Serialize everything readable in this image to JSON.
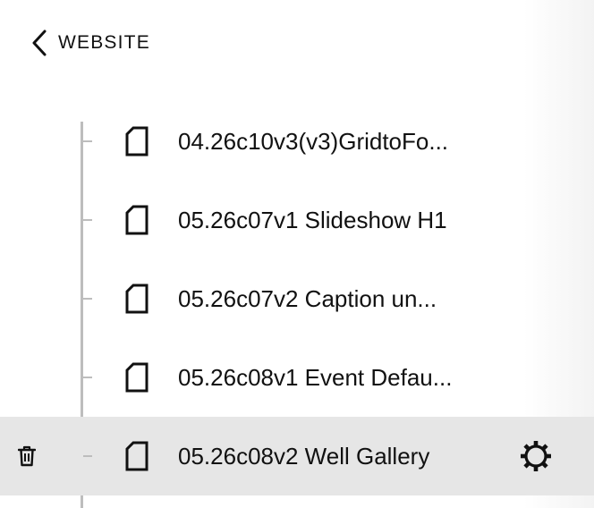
{
  "header": {
    "back_label": "WEBSITE",
    "back_icon": "chevron-left-icon"
  },
  "pages": [
    {
      "label": "04.26c10v3(v3)GridtoFo...",
      "icon": "page-icon",
      "selected": false
    },
    {
      "label": "05.26c07v1 Slideshow H1",
      "icon": "page-icon",
      "selected": false
    },
    {
      "label": "05.26c07v2 Caption un...",
      "icon": "page-icon",
      "selected": false
    },
    {
      "label": "05.26c08v1 Event Defau...",
      "icon": "page-icon",
      "selected": false
    },
    {
      "label": "05.26c08v2 Well Gallery",
      "icon": "page-icon",
      "selected": true
    }
  ],
  "selected_actions": {
    "delete_icon": "trash-icon",
    "settings_icon": "gear-icon"
  },
  "colors": {
    "selected_row": "#e6e6e6",
    "tree_line": "#bdbdbd",
    "text": "#111111"
  }
}
